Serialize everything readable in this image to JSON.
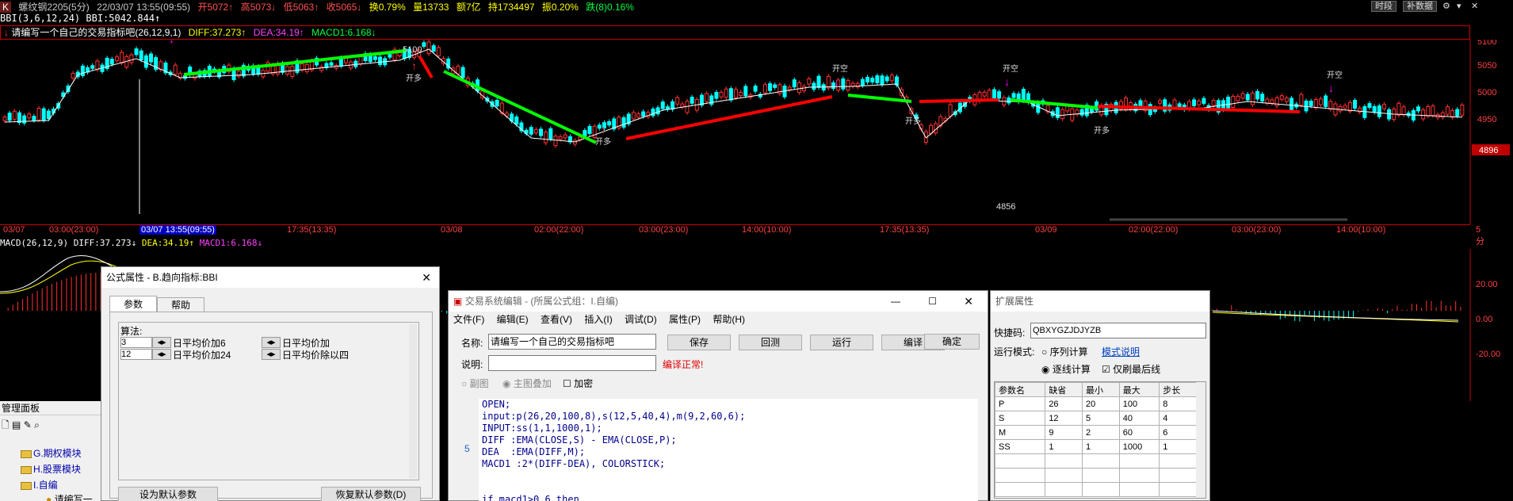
{
  "topbar": {
    "icon": "K",
    "symbol": "螺纹钢2205(5分)",
    "datetime": "22/03/07 13:55(09:55)",
    "open": "开5072↑",
    "high": "高5073↓",
    "low": "低5063↑",
    "close": "收5065↓",
    "turnover": "换0.79%",
    "volume": "量13733",
    "amount": "额7亿",
    "position": "持1734497",
    "amplitude": "振0.20%",
    "change": "跌(8)0.16%",
    "btn_time": "时段",
    "btn_fill": "补数据"
  },
  "bbi_label": "BBI(3,6,12,24) BBI:5042.844↑",
  "indicator": {
    "name": "请编写一个自己的交易指标吧(26,12,9,1)",
    "diff": "DIFF:37.273↑",
    "dea": "DEA:34.19↑",
    "macd1": "MACD1:6.168↓"
  },
  "price_axis": [
    "5100",
    "5050",
    "5000",
    "4950"
  ],
  "current_price": "4896",
  "chart_annotations": {
    "high_label": "5100",
    "low_label": "4856",
    "buy_text": "开多",
    "sell_text": "开空",
    "up_marker": "↑",
    "down_marker": "↓"
  },
  "x_axis": [
    "03/07",
    "03:00(23:00)",
    "03/07 13:55(09:55)",
    "17:35(13:35)",
    "03/08",
    "02:00(22:00)",
    "03:00(23:00)",
    "14:00(10:00)",
    "17:35(13:35)",
    "03/09",
    "02:00(22:00)",
    "03:00(23:00)",
    "14:00(10:00)",
    "5分"
  ],
  "macd_label": {
    "name": "MACD(26,12,9)",
    "diff": "DIFF:37.273↓",
    "dea": "DEA:34.19↑",
    "macd": "MACD1:6.168↓"
  },
  "macd_axis": [
    "20.00",
    "0.00",
    "-20.00"
  ],
  "formula_window": {
    "title": "公式属性 - B.趋向指标:BBI",
    "tabs": [
      "参数",
      "帮助"
    ],
    "algo_label": "算法:",
    "rows": [
      {
        "val": "3",
        "a": "日平均价加6",
        "b": "日平均价加"
      },
      {
        "val": "12",
        "a": "日平均价加24",
        "b": "日平均价除以四"
      }
    ],
    "btn_set_default": "设为默认参数",
    "btn_restore_default": "恢复默认参数(D)"
  },
  "editor_window": {
    "title": "交易系统编辑 - (所属公式组：I.自编)",
    "menu": [
      "文件(F)",
      "编辑(E)",
      "查看(V)",
      "插入(I)",
      "调试(D)",
      "属性(P)",
      "帮助(H)"
    ],
    "name_label": "名称:",
    "name_value": "请编写一个自己的交易指标吧",
    "buttons": [
      "保存",
      "回测",
      "运行",
      "编译",
      "确定"
    ],
    "desc_label": "说明:",
    "compile_status": "编译正常!",
    "radio_sub": "副图",
    "radio_main": "主图叠加",
    "encrypt": "加密",
    "line_marker": "5",
    "code": [
      "OPEN;",
      "input:p(26,20,100,8),s(12,5,40,4),m(9,2,60,6);",
      "INPUT:ss(1,1,1000,1);",
      "DIFF :EMA(CLOSE,S) - EMA(CLOSE,P);",
      "DEA  :EMA(DIFF,M);",
      "MACD1 :2*(DIFF-DEA), COLORSTICK;",
      "",
      "",
      "if macd1>0.6 then"
    ]
  },
  "ext_window": {
    "title": "扩展属性",
    "quick_label": "快捷码:",
    "quick_value": "QBXYGZJDJYZB",
    "mode_label": "运行模式:",
    "mode_seq": "序列计算",
    "mode_help": "模式说明",
    "mode_tick": "逐线计算",
    "only_last": "仅刷最后线",
    "table_headers": [
      "参数名",
      "缺省",
      "最小",
      "最大",
      "步长"
    ],
    "table_rows": [
      [
        "P",
        "26",
        "20",
        "100",
        "8"
      ],
      [
        "S",
        "12",
        "5",
        "40",
        "4"
      ],
      [
        "M",
        "9",
        "2",
        "60",
        "6"
      ],
      [
        "SS",
        "1",
        "1",
        "1000",
        "1"
      ]
    ]
  },
  "mgmt_panel": {
    "title": "管理面板",
    "items": [
      "G.期权模块",
      "H.股票模块",
      "I.自编",
      "请编写一"
    ]
  },
  "colors": {
    "up": "#ff3030",
    "down": "#00ffff",
    "bbi": "#ffffff",
    "green_trend": "#00ff00",
    "red_trend": "#ff0000",
    "axis": "#c00000",
    "magenta": "#ff00ff"
  }
}
